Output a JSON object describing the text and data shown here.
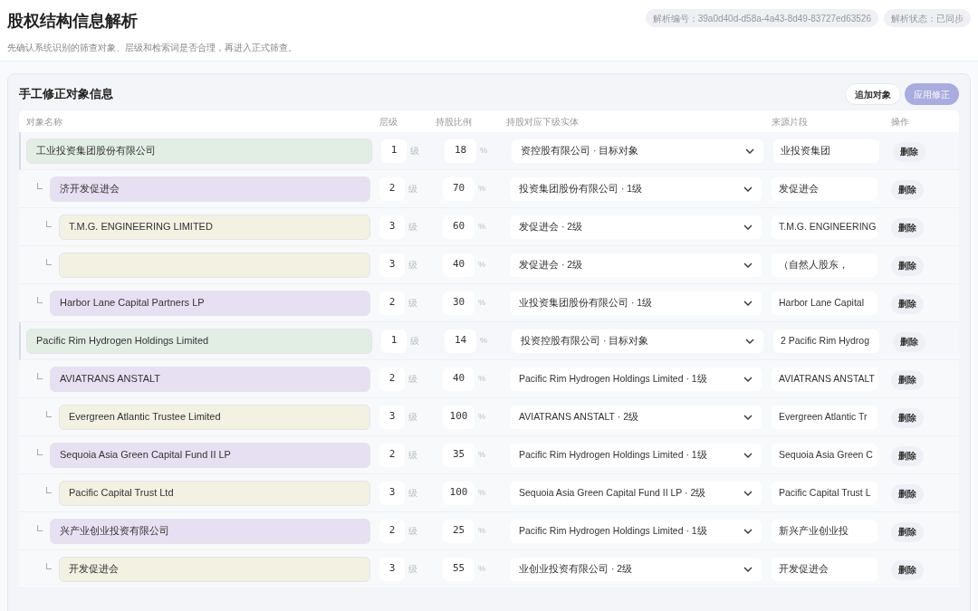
{
  "header": {
    "title": "股权结构信息解析",
    "subtitle": "先确认系统识别的筛查对象、层级和检索词是否合理，再进入正式筛查。",
    "badges": [
      "解析编号：39a0d40d-d58a-4a43-8d49-83727ed63526",
      "解析状态：已同步"
    ]
  },
  "card": {
    "title": "手工修正对象信息",
    "add_button": "追加对象",
    "apply_button": {
      "label": "应用修正",
      "disabled": true
    },
    "columns": [
      "对象名称",
      "层级",
      "持股比例",
      "持股对应下级实体",
      "来源片段",
      "操作"
    ],
    "rows": [
      {
        "name": "工业投资集团股份有限公司",
        "level": "1",
        "level_unit": "级",
        "pct": "18",
        "pct_unit": "%",
        "parent": "资控股有限公司 · 目标对象",
        "source": "业投资集团",
        "action": "删除",
        "children": [
          {
            "name": "济开发促进会",
            "level": "2",
            "level_unit": "级",
            "pct": "70",
            "pct_unit": "%",
            "parent": "投资集团股份有限公司 · 1级",
            "source": "发促进会",
            "action": "删除",
            "children": [
              {
                "name": "T.M.G. ENGINEERING LIMITED",
                "level": "3",
                "level_unit": "级",
                "pct": "60",
                "pct_unit": "%",
                "parent": "发促进会 · 2级",
                "source": "T.M.G. ENGINEERING",
                "action": "删除"
              },
              {
                "level": "3",
                "level_unit": "级",
                "pct": "40",
                "pct_unit": "%",
                "parent": "发促进会 · 2级",
                "source": "（自然人股东，",
                "action": "删除"
              }
            ]
          },
          {
            "name": "Harbor Lane Capital Partners LP",
            "level": "2",
            "level_unit": "级",
            "pct": "30",
            "pct_unit": "%",
            "parent": "业投资集团股份有限公司 · 1级",
            "source": "Harbor Lane Capital",
            "action": "删除"
          }
        ]
      },
      {
        "name": "Pacific Rim Hydrogen Holdings Limited",
        "level": "1",
        "level_unit": "级",
        "pct": "14",
        "pct_unit": "%",
        "parent": "投资控股有限公司 · 目标对象",
        "source": "2 Pacific Rim Hydrog",
        "action": "删除",
        "children": [
          {
            "name": "AVIATRANS ANSTALT",
            "level": "2",
            "level_unit": "级",
            "pct": "40",
            "pct_unit": "%",
            "parent": "Pacific Rim Hydrogen Holdings Limited · 1级",
            "source": "AVIATRANS ANSTALT",
            "action": "删除",
            "children": [
              {
                "name": "Evergreen Atlantic Trustee Limited",
                "level": "3",
                "level_unit": "级",
                "pct": "100",
                "pct_unit": "%",
                "parent": "AVIATRANS ANSTALT · 2级",
                "source": "Evergreen Atlantic Tr",
                "action": "删除"
              }
            ]
          },
          {
            "name": "Sequoia Asia Green Capital Fund II LP",
            "level": "2",
            "level_unit": "级",
            "pct": "35",
            "pct_unit": "%",
            "parent": "Pacific Rim Hydrogen Holdings Limited · 1级",
            "source": "Sequoia Asia Green C",
            "action": "删除",
            "children": [
              {
                "name": "Pacific Capital Trust Ltd",
                "level": "3",
                "level_unit": "级",
                "pct": "100",
                "pct_unit": "%",
                "parent": "Sequoia Asia Green Capital Fund II LP · 2级",
                "source": "Pacific Capital Trust L",
                "action": "删除"
              }
            ]
          },
          {
            "name": "兴产业创业投资有限公司",
            "level": "2",
            "level_unit": "级",
            "pct": "25",
            "pct_unit": "%",
            "parent": "Pacific Rim Hydrogen Holdings Limited · 1级",
            "source": "新兴产业创业投",
            "action": "删除",
            "children": [
              {
                "name": "开发促进会",
                "level": "3",
                "level_unit": "级",
                "pct": "55",
                "pct_unit": "%",
                "parent": "业创业投资有限公司 · 2级",
                "source": "开发促进会",
                "action": "删除"
              }
            ]
          }
        ]
      }
    ]
  }
}
